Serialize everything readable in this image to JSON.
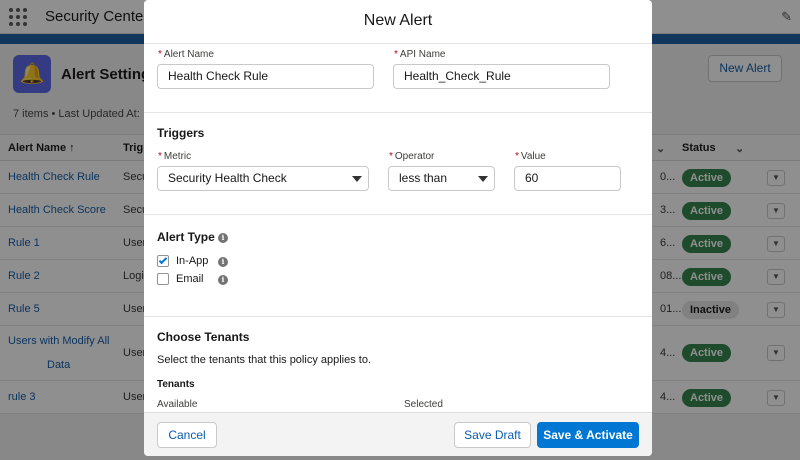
{
  "app": {
    "title": "Security Center",
    "header_title": "Alert Settings",
    "meta": "7 items • Last Updated At:",
    "new_alert_label": "New Alert"
  },
  "table": {
    "headers": {
      "name": "Alert Name ↑",
      "triggers": "Trig",
      "status": "Status"
    },
    "rows": [
      {
        "name": "Health Check Rule",
        "trigger": "Secu",
        "clip": "0...",
        "status": "Active"
      },
      {
        "name": "Health Check Score",
        "trigger": "Secu",
        "clip": "3...",
        "status": "Active"
      },
      {
        "name": "Rule 1",
        "trigger": "User",
        "clip": "6...",
        "status": "Active"
      },
      {
        "name": "Rule 2",
        "trigger": "Logi",
        "clip": "08...",
        "status": "Active"
      },
      {
        "name": "Rule 5",
        "trigger": "User",
        "clip": "01...",
        "status": "Inactive"
      },
      {
        "name": "Users with Modify All",
        "name2": "Data",
        "trigger": "User",
        "clip": "4...",
        "status": "Active"
      },
      {
        "name": "rule 3",
        "trigger": "User",
        "clip": "4...",
        "status": "Active"
      }
    ]
  },
  "modal": {
    "title": "New Alert",
    "alert_name_label": "Alert Name",
    "alert_name_value": "Health Check Rule",
    "api_name_label": "API Name",
    "api_name_value": "Health_Check_Rule",
    "triggers_title": "Triggers",
    "metric_label": "Metric",
    "metric_value": "Security Health Check",
    "operator_label": "Operator",
    "operator_value": "less than",
    "value_label": "Value",
    "value_value": "60",
    "alert_type_title": "Alert Type",
    "in_app_label": "In-App",
    "in_app_checked": true,
    "email_label": "Email",
    "email_checked": false,
    "tenants_title": "Choose Tenants",
    "tenants_desc": "Select the tenants that this policy applies to.",
    "tenants_label": "Tenants",
    "available_label": "Available",
    "selected_label": "Selected",
    "cancel_label": "Cancel",
    "save_draft_label": "Save Draft",
    "save_activate_label": "Save & Activate"
  },
  "colors": {
    "brand": "#0176d3",
    "link": "#0b5cab",
    "active_badge": "#2e844a",
    "required": "#ba0517"
  },
  "icons": [
    "app-launcher-icon",
    "edit-icon",
    "alert-settings-icon",
    "sort-arrow-icon",
    "chevron-down-icon",
    "info-icon",
    "checkbox-check-icon",
    "select-caret-icon"
  ]
}
